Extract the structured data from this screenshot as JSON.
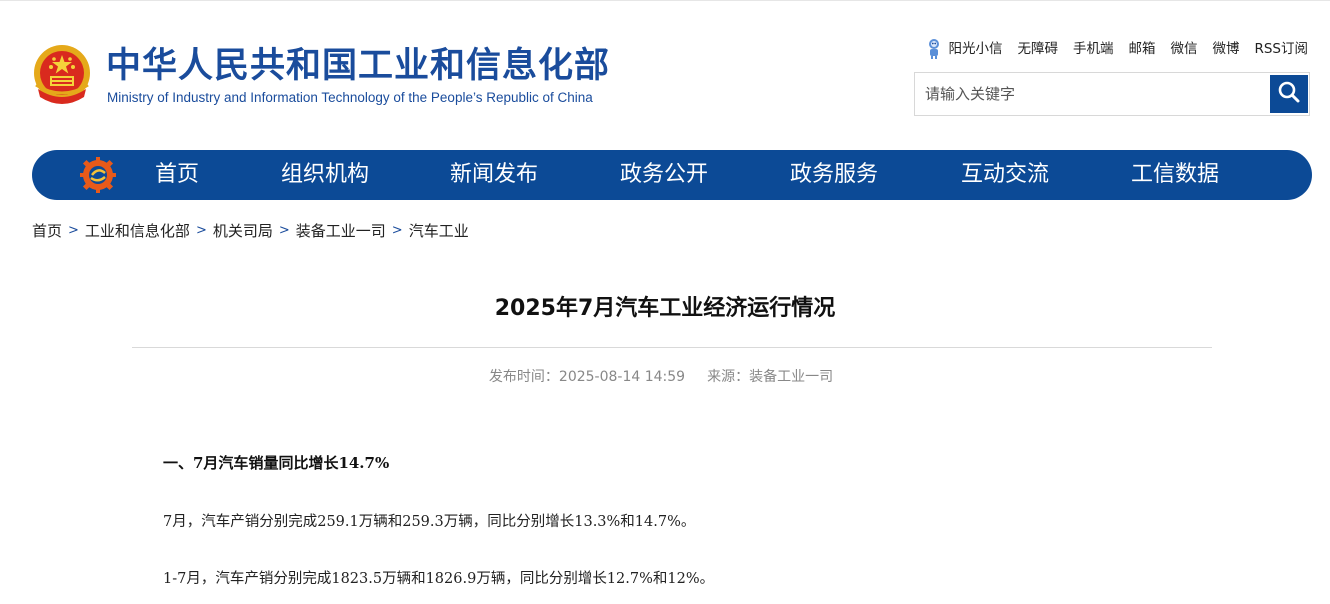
{
  "header": {
    "title_cn": "中华人民共和国工业和信息化部",
    "title_en": "Ministry of Industry and Information Technology of the People’s Republic of China",
    "emblem_icon": "national-emblem-icon"
  },
  "toplinks": [
    {
      "label": "阳光小信",
      "icon": "robot-icon"
    },
    {
      "label": "无障碍"
    },
    {
      "label": "手机端"
    },
    {
      "label": "邮箱"
    },
    {
      "label": "微信"
    },
    {
      "label": "微博"
    },
    {
      "label": "RSS订阅"
    }
  ],
  "search": {
    "placeholder": "请输入关键字",
    "value": "",
    "button_icon": "search-icon"
  },
  "nav": {
    "logo_icon": "gear-logo-icon",
    "items": [
      "首页",
      "组织机构",
      "新闻发布",
      "政务公开",
      "政务服务",
      "互动交流",
      "工信数据"
    ]
  },
  "breadcrumb": {
    "items": [
      "首页",
      "工业和信息化部",
      "机关司局",
      "装备工业一司",
      "汽车工业"
    ],
    "separator": ">"
  },
  "article": {
    "title": "2025年7月汽车工业经济运行情况",
    "publish_label": "发布时间：",
    "publish_time": "2025-08-14 14:59",
    "source_label": "来源：",
    "source": "装备工业一司",
    "section_heading": "一、7月汽车销量同比增长14.7%",
    "paragraphs": [
      "7月，汽车产销分别完成259.1万辆和259.3万辆，同比分别增长13.3%和14.7%。",
      "1-7月，汽车产销分别完成1823.5万辆和1826.9万辆，同比分别增长12.7%和12%。"
    ]
  },
  "colors": {
    "brand_blue": "#0c4a96",
    "title_blue": "#1a4c9c"
  }
}
